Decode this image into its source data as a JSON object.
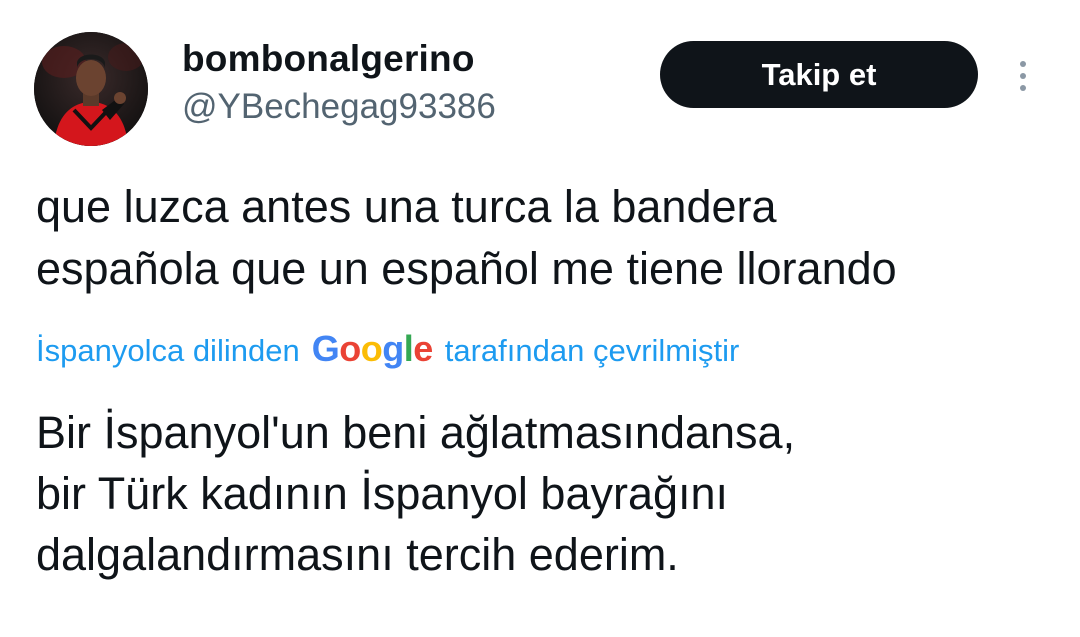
{
  "user": {
    "display_name": "bombonalgerino",
    "handle": "@YBechegag93386"
  },
  "actions": {
    "follow_label": "Takip et",
    "more_icon": "more-vertical-icon"
  },
  "tweet": {
    "lines": [
      "que luzca antes una turca la bandera",
      "española que un español me tiene llorando"
    ]
  },
  "translation": {
    "prefix": "İspanyolca dilinden",
    "provider": {
      "letters": [
        "G",
        "o",
        "o",
        "g",
        "l",
        "e"
      ]
    },
    "suffix": "tarafından çevrilmiştir",
    "lines": [
      "Bir İspanyol'un beni ağlatmasındansa,",
      "bir Türk kadının İspanyol bayrağını",
      "dalgalandırmasını tercih ederim."
    ]
  },
  "colors": {
    "link": "#1d9bf0",
    "button_bg": "#0f1419",
    "handle": "#536471"
  }
}
